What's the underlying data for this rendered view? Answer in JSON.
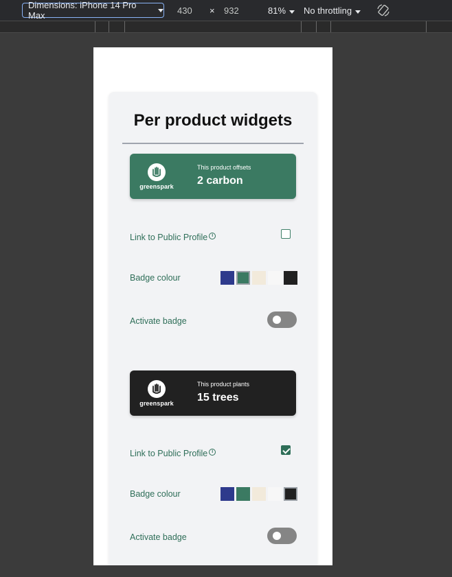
{
  "devtools": {
    "dimensions_label": "Dimensions: iPhone 14 Pro Max",
    "width": "430",
    "times": "×",
    "height": "932",
    "zoom": "81%",
    "throttle": "No throttling"
  },
  "page": {
    "title": "Per product widgets"
  },
  "widgets": [
    {
      "badge": {
        "logo_text": "greenspark",
        "small_text": "This product offsets",
        "big_text": "2 carbon",
        "color": "#3b7a62"
      },
      "profile_label": "Link to Public Profile",
      "profile_checked": false,
      "badge_colour_label": "Badge colour",
      "activate_label": "Activate badge",
      "activated": false,
      "selected_swatch": "green"
    },
    {
      "badge": {
        "logo_text": "greenspark",
        "small_text": "This product plants",
        "big_text": "15 trees",
        "color": "#212121"
      },
      "profile_label": "Link to Public Profile",
      "profile_checked": true,
      "badge_colour_label": "Badge colour",
      "activate_label": "Activate badge",
      "activated": false,
      "selected_swatch": "black"
    }
  ],
  "swatch_colors": [
    "#2e3a8c",
    "#3b7a62",
    "#f2eadb",
    "#f7f7f7",
    "#212121"
  ],
  "icons": [
    "caret-down-icon",
    "rotate-icon",
    "info-icon",
    "check-icon",
    "greenspark-logo-icon"
  ]
}
